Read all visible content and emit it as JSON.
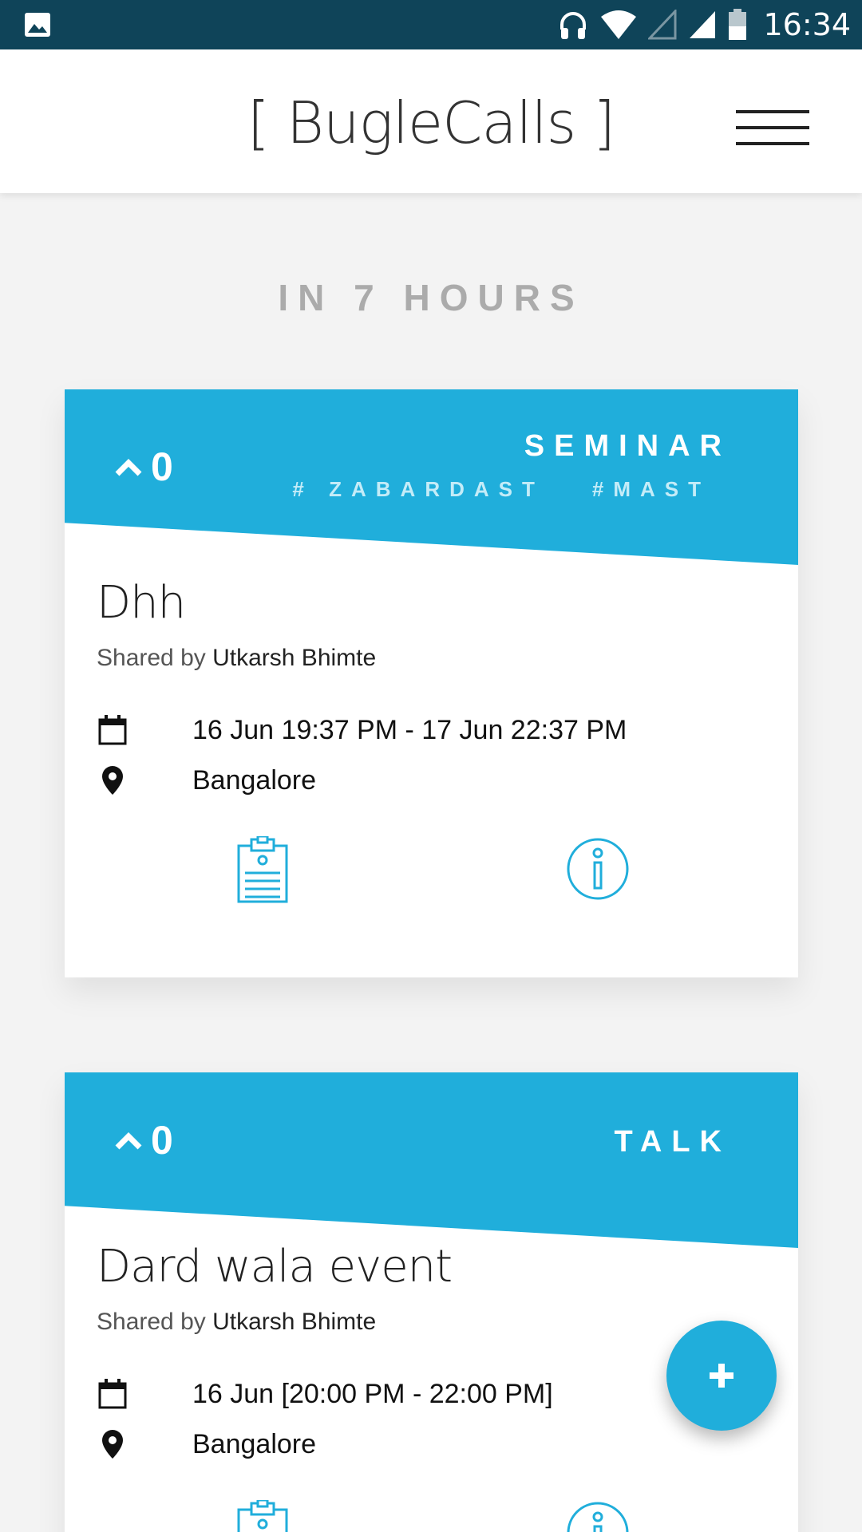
{
  "status_bar": {
    "time": "16:34",
    "icons": [
      "gallery-icon",
      "headphones-icon",
      "wifi-icon",
      "signal-empty-icon",
      "signal-full-icon",
      "battery-icon"
    ]
  },
  "app_bar": {
    "title": "[ BugleCalls ]",
    "menu_icon": "hamburger-menu-icon"
  },
  "section": {
    "heading": "IN 7 HOURS"
  },
  "events": [
    {
      "upvotes": "0",
      "category": "SEMINAR",
      "tags": [
        "# ZABARDAST",
        "#MAST"
      ],
      "title": "Dhh",
      "shared_by_prefix": "Shared by",
      "shared_by_name": "Utkarsh Bhimte",
      "datetime": "16 Jun 19:37 PM - 17 Jun 22:37 PM",
      "location": "Bangalore"
    },
    {
      "upvotes": "0",
      "category": "TALK",
      "tags": [],
      "title": "Dard wala event",
      "shared_by_prefix": "Shared by",
      "shared_by_name": "Utkarsh Bhimte",
      "datetime": "16 Jun [20:00 PM - 22:00 PM]",
      "location": "Bangalore"
    }
  ],
  "fab": {
    "label": "+",
    "icon": "plus-icon"
  },
  "colors": {
    "status_bar": "#0f4459",
    "accent": "#20aedb",
    "background": "#f3f3f3",
    "heading_gray": "#ababab"
  }
}
